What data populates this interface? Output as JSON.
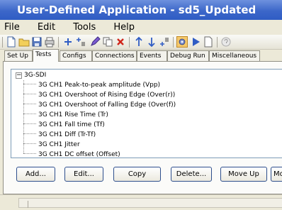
{
  "window": {
    "title": "User-Defined Application - sd5_Updated"
  },
  "menu": [
    "File",
    "Edit",
    "Tools",
    "Help"
  ],
  "toolbar": {
    "icons": [
      "new-icon",
      "open-icon",
      "save-icon",
      "print-icon",
      "add-icon",
      "insert-icon",
      "edit-icon",
      "copy-icon",
      "delete-icon",
      "move-up-icon",
      "move-down-icon",
      "insert-after-icon",
      "settings-icon",
      "run-icon",
      "page-icon",
      "help-icon"
    ]
  },
  "tabs": [
    "Set Up",
    "Tests",
    "Configs",
    "Connections",
    "Events",
    "Debug Run",
    "Miscellaneous"
  ],
  "active_tab": "Tests",
  "tree": {
    "root": "3G-SDI",
    "items": [
      "3G CH1 Peak-to-peak amplitude (Vpp)",
      "3G CH1 Overshoot of Rising Edge (Over(r))",
      "3G CH1 Overshoot of Falling Edge (Over(f))",
      "3G CH1 Rise Time (Tr)",
      "3G CH1 Fall time (Tf)",
      "3G CH1 Diff (Tr-Tf)",
      "3G CH1 Jitter",
      "3G CH1 DC offset (Offset)"
    ]
  },
  "buttons": {
    "add": "Add...",
    "edit": "Edit...",
    "copy": "Copy",
    "delete": "Delete...",
    "move_up": "Move Up",
    "more": "Mo"
  }
}
